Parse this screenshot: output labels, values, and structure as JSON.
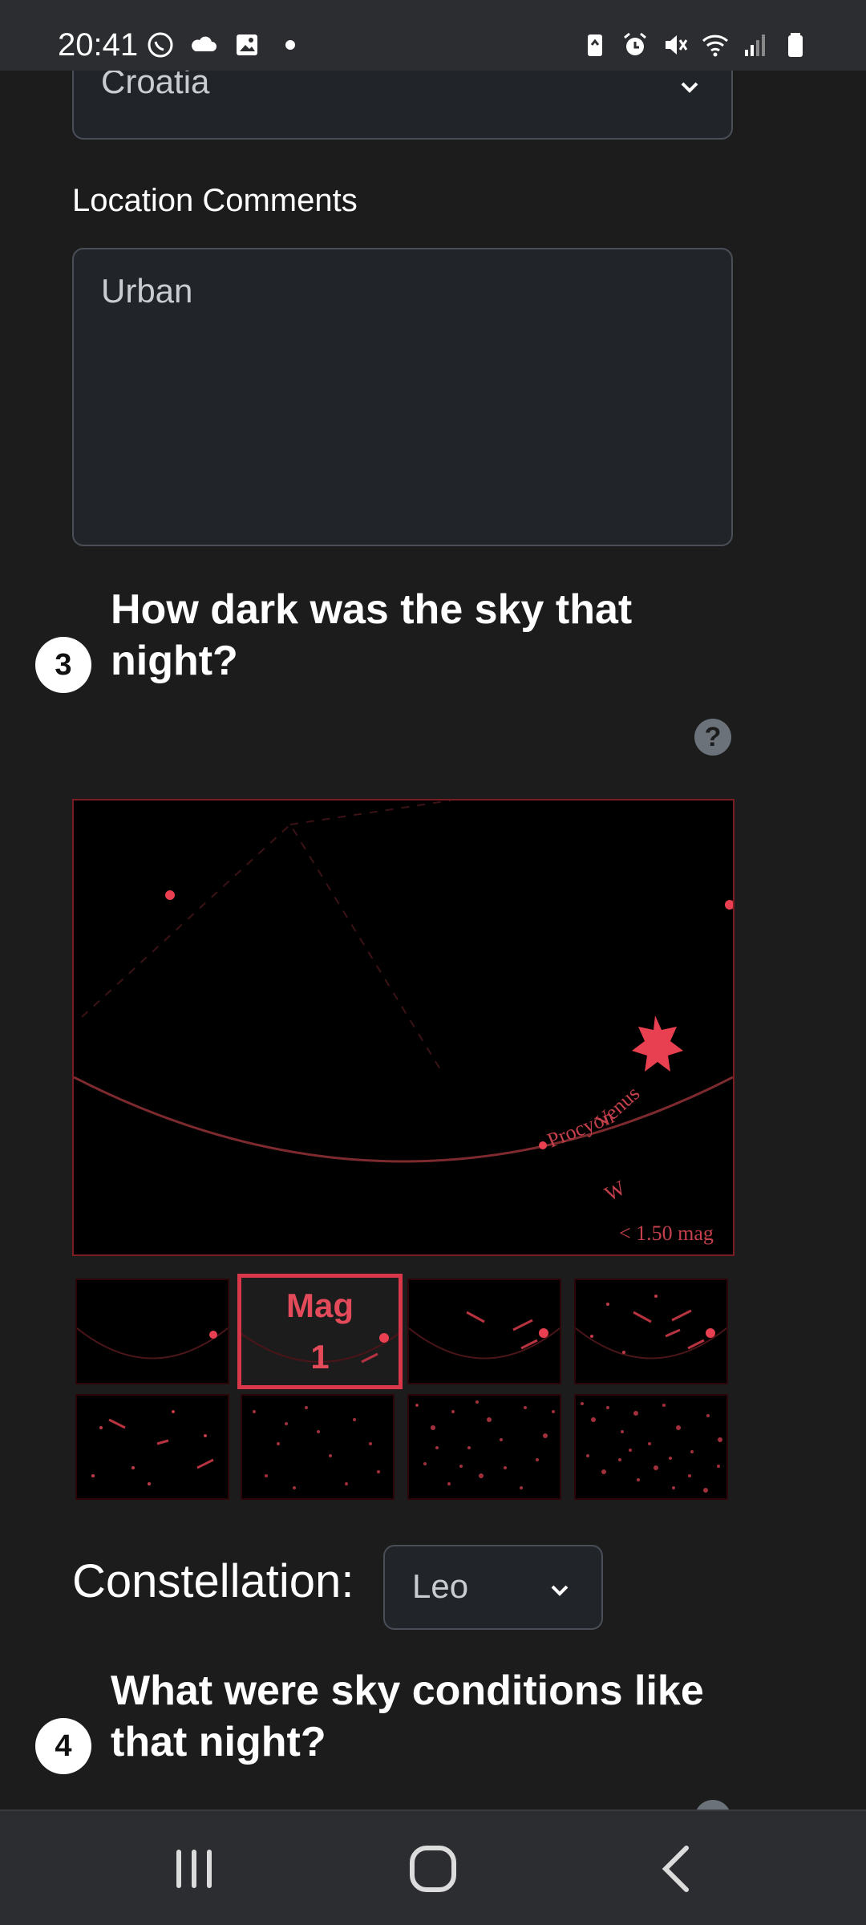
{
  "status_bar": {
    "time": "20:41",
    "left_icons": [
      "viber-icon",
      "cloud-icon",
      "gallery-icon",
      "dot-icon"
    ],
    "right_icons": [
      "battery-saver-icon",
      "alarm-icon",
      "mute-icon",
      "wifi-icon",
      "signal-icon",
      "battery-icon"
    ]
  },
  "location": {
    "country_value": "Croatia",
    "comments_label": "Location Comments",
    "comments_value": "Urban"
  },
  "step3": {
    "number": "3",
    "heading": "How dark was the sky that night?",
    "help_symbol": "?",
    "chart_labels": {
      "planet": "Venus",
      "star": "Procyon",
      "direction": "W",
      "magnitude": "< 1.50 mag"
    },
    "selected_thumb_line1": "Mag",
    "selected_thumb_line2": "1",
    "magnitude_options_count": 8,
    "selected_index": 1
  },
  "constellation": {
    "label": "Constellation:",
    "value": "Leo"
  },
  "step4": {
    "number": "4",
    "heading": "What were sky conditions like that night?"
  },
  "nav": {
    "buttons": [
      "recents-icon",
      "home-icon",
      "back-icon"
    ]
  },
  "colors": {
    "accent_red": "#d9374a",
    "chart_red": "#e84050",
    "background": "#1c1c1d"
  }
}
